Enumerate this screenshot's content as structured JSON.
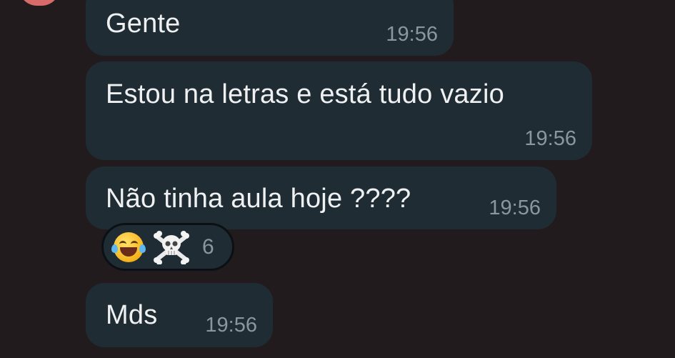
{
  "messages": [
    {
      "text": "Gente",
      "time": "19:56"
    },
    {
      "text": "Estou na letras e está tudo vazio",
      "time": "19:56"
    },
    {
      "text": "Não tinha aula hoje ????",
      "time": "19:56"
    },
    {
      "text": "Mds",
      "time": "19:56"
    }
  ],
  "reactions": {
    "icons": [
      "laughing-tears-icon",
      "skull-crossbones-icon"
    ],
    "count": "6"
  },
  "colors": {
    "background": "#221b1d",
    "bubble": "#1f2c33",
    "text": "#eef0f1",
    "timestamp": "#8c979d",
    "avatar": "#d96a6a"
  }
}
